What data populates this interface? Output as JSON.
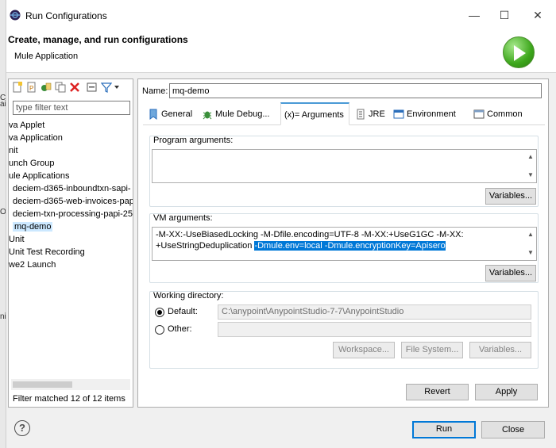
{
  "window": {
    "title": "Run Configurations",
    "controls": {
      "minimize": "—",
      "maximize": "☐",
      "close": "✕"
    }
  },
  "header": {
    "title": "Create, manage, and run configurations",
    "subtitle": "Mule Application"
  },
  "left_strip": [
    "Co",
    "ai",
    "Or",
    "ni"
  ],
  "left_panel": {
    "filter_placeholder": "type filter text",
    "tree": [
      {
        "label": "va Applet",
        "indent": 0
      },
      {
        "label": "va Application",
        "indent": 0
      },
      {
        "label": "nit",
        "indent": 0
      },
      {
        "label": "unch Group",
        "indent": 0
      },
      {
        "label": "ule Applications",
        "indent": 0
      },
      {
        "label": "deciem-d365-inboundtxn-sapi-",
        "indent": 1
      },
      {
        "label": "deciem-d365-web-invoices-pap",
        "indent": 1
      },
      {
        "label": "deciem-txn-processing-papi-25",
        "indent": 1
      },
      {
        "label": "mq-demo",
        "indent": 1,
        "selected": true
      },
      {
        "label": "Unit",
        "indent": 0
      },
      {
        "label": "Unit Test Recording",
        "indent": 0
      },
      {
        "label": "we2 Launch",
        "indent": 0
      }
    ],
    "status": "Filter matched 12 of 12 items"
  },
  "config": {
    "name_label": "Name:",
    "name_value": "mq-demo",
    "tabs": [
      {
        "label": "General",
        "icon": "general-icon",
        "active": false
      },
      {
        "label": "Mule Debug...",
        "icon": "bug-icon",
        "active": false
      },
      {
        "label": "(x)= Arguments",
        "icon": "",
        "active": true
      },
      {
        "label": "JRE",
        "icon": "jre-icon",
        "active": false
      },
      {
        "label": "Environment",
        "icon": "environment-icon",
        "active": false
      },
      {
        "label": "Common",
        "icon": "common-icon",
        "active": false
      }
    ],
    "program_args": {
      "label": "Program arguments:",
      "value": "",
      "variables_button": "Variables..."
    },
    "vm_args": {
      "label": "VM arguments:",
      "line1": "-M-XX:-UseBiasedLocking -M-Dfile.encoding=UTF-8 -M-XX:+UseG1GC -M-XX:",
      "line2_plain": "+UseStringDeduplication ",
      "line2_selected": "-Dmule.env=local -Dmule.encryptionKey=Apisero",
      "variables_button": "Variables..."
    },
    "working_dir": {
      "label": "Working directory:",
      "default_label": "Default:",
      "default_value": "C:\\anypoint\\AnypointStudio-7-7\\AnypointStudio",
      "other_label": "Other:",
      "other_value": "",
      "selected": "default",
      "buttons": [
        "Workspace...",
        "File System...",
        "Variables..."
      ]
    },
    "revert_button": "Revert",
    "apply_button": "Apply"
  },
  "footer": {
    "help": "?",
    "run_button": "Run",
    "close_button": "Close"
  },
  "colors": {
    "selection": "#0078d7",
    "tree_selection": "#cce8ff",
    "active_tab_accent": "#4a9ad6"
  }
}
